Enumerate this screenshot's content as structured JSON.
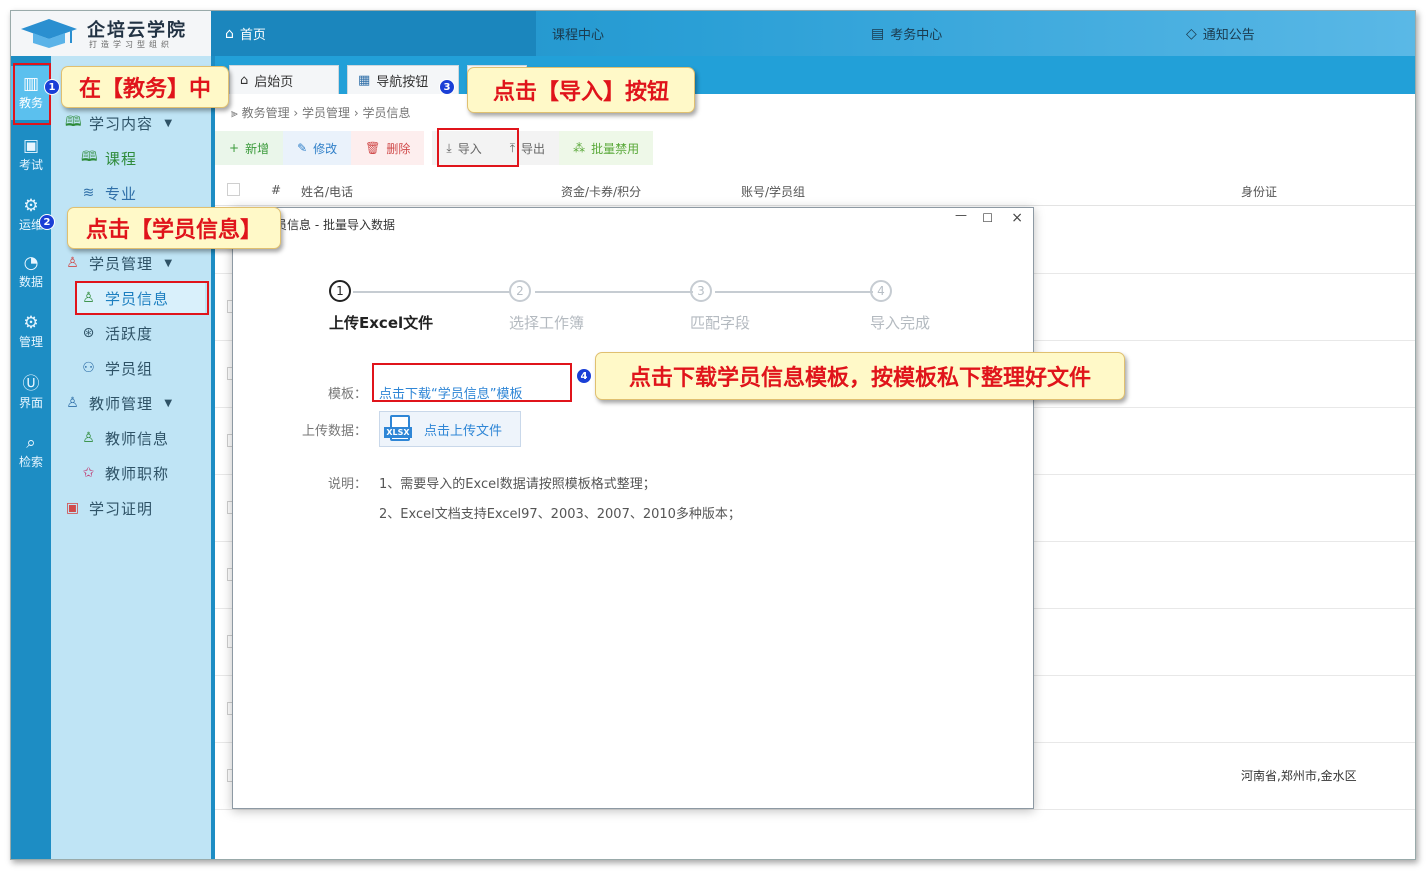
{
  "logo": {
    "name": "企培云学院",
    "slogan": "打造学习型组织"
  },
  "topnav": {
    "home": "首页",
    "course_center": "课程中心",
    "exam_center": "考务中心",
    "notice": "通知公告"
  },
  "rail": [
    "教务",
    "考试",
    "运维",
    "数据",
    "管理",
    "界面",
    "检索"
  ],
  "submenu": {
    "study_content": "学习内容",
    "course": "课程",
    "major": "专业",
    "student_mgmt": "学员管理",
    "student_info": "学员信息",
    "activity": "活跃度",
    "student_group": "学员组",
    "teacher_mgmt": "教师管理",
    "teacher_info": "教师信息",
    "teacher_title": "教师职称",
    "study_cert": "学习证明"
  },
  "tabs": {
    "start": "启始页",
    "nav": "导航按钮"
  },
  "breadcrumb": "教务管理 › 学员管理 › 学员信息",
  "toolbar": {
    "add": "新增",
    "edit": "修改",
    "delete": "删除",
    "import": "导入",
    "export": "导出",
    "batch_disable": "批量禁用"
  },
  "table": {
    "headers": {
      "index": "#",
      "name": "姓名/电话",
      "funds": "资金/卡券/积分",
      "account": "账号/学员组",
      "idcard": "身份证"
    },
    "last_row_address": "河南省,郑州市,金水区"
  },
  "modal": {
    "title": "学员信息 - 批量导入数据",
    "steps": [
      "上传Excel文件",
      "选择工作簿",
      "匹配字段",
      "导入完成"
    ],
    "template_label": "模板：",
    "template_link": "点击下载“学员信息”模板",
    "upload_label": "上传数据：",
    "upload_button": "点击上传文件",
    "note_label": "说明：",
    "note1": "1、需要导入的Excel数据请按照模板格式整理；",
    "note2": "2、Excel文档支持Excel97、2003、2007、2010多种版本；"
  },
  "annotations": {
    "c1": "在【教务】中",
    "c2": "点击【学员信息】",
    "c3": "点击【导入】按钮",
    "c4": "点击下载学员信息模板，按模板私下整理好文件",
    "badges": [
      "1",
      "2",
      "3",
      "4"
    ]
  }
}
